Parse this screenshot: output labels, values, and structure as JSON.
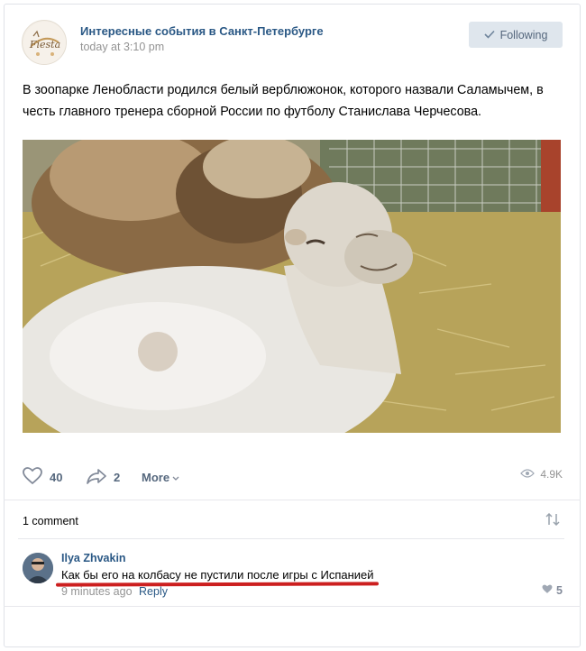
{
  "post": {
    "group_name": "Интересные события в Санкт-Петербурге",
    "time": "today at 3:10 pm",
    "follow_label": "Following",
    "text": "В зоопарке Ленобласти родился белый верблюжонок, которого назвали Саламычем, в честь главного тренера сборной России по футболу Станислава Черчесова.",
    "photo_icon": "baby-camel-photo"
  },
  "actions": {
    "likes": "40",
    "shares": "2",
    "more_label": "More",
    "views": "4.9K"
  },
  "comments": {
    "count_label": "1 comment",
    "items": [
      {
        "author": "Ilya Zhvakin",
        "text": "Как бы его на колбасу не пустили после игры с Испанией",
        "time": "9 minutes ago",
        "reply_label": "Reply",
        "likes": "5"
      }
    ]
  },
  "colors": {
    "link": "#2a5885",
    "muted": "#939393",
    "button_bg": "#dfe6ed",
    "highlight": "#cc1f1f"
  }
}
